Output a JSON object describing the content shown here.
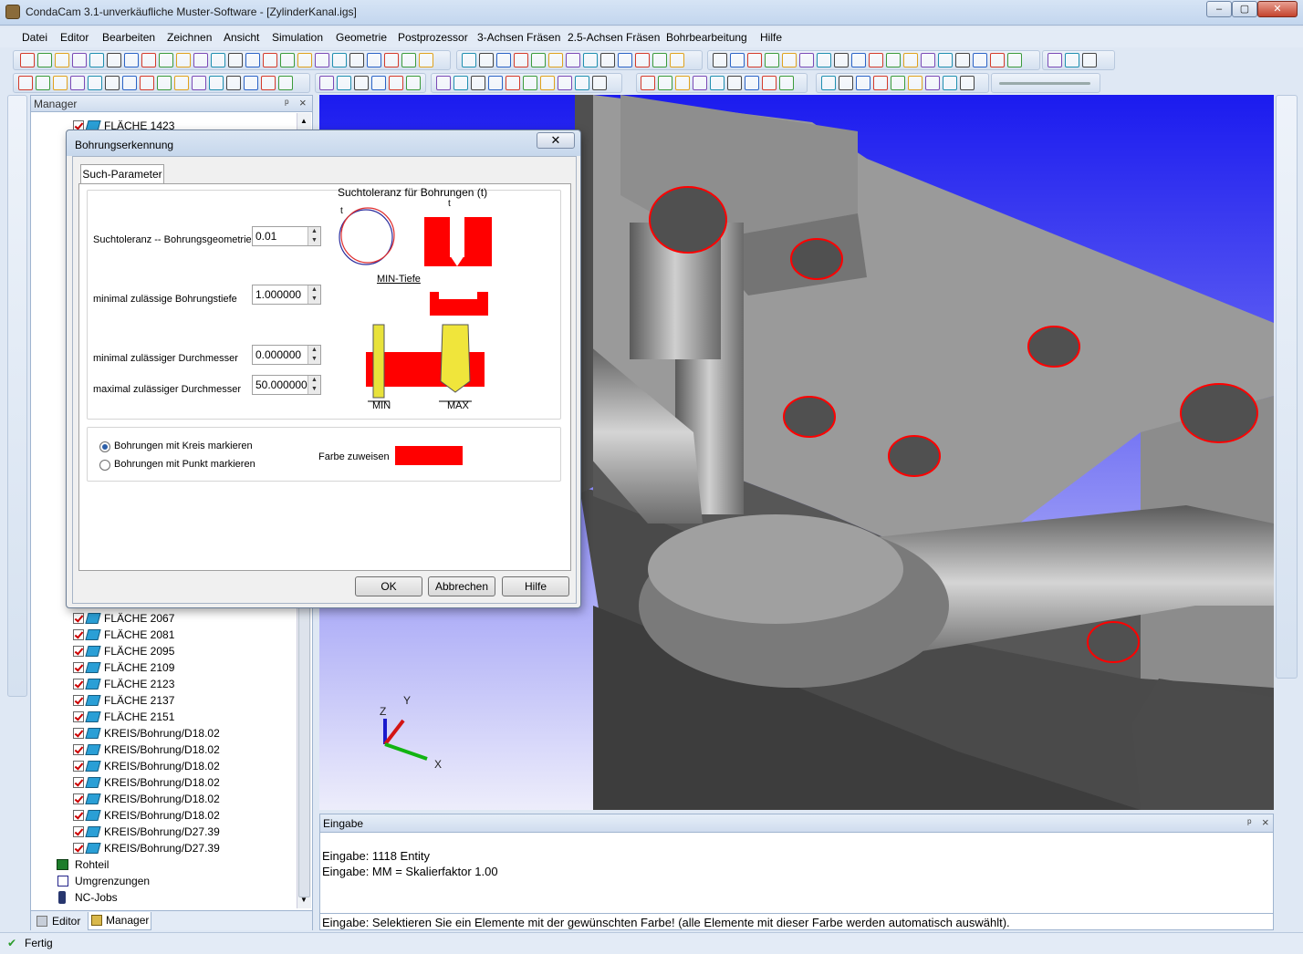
{
  "window": {
    "title": "CondaCam 3.1-unverkäufliche Muster-Software - [ZylinderKanal.igs]",
    "min": "–",
    "max": "▢",
    "close": "✕"
  },
  "menu": [
    "Datei",
    "Editor",
    "Bearbeiten",
    "Zeichnen",
    "Ansicht",
    "Simulation",
    "Geometrie",
    "Postprozessor",
    "3-Achsen Fräsen",
    "2.5-Achsen Fräsen",
    "Bohrbearbeitung",
    "Hilfe"
  ],
  "manager": {
    "title": "Manager",
    "pin": "ᵖ",
    "close": "×",
    "top_item": "FLÄCHE 1423",
    "items": [
      "FLÄCHE 2067",
      "FLÄCHE 2081",
      "FLÄCHE 2095",
      "FLÄCHE 2109",
      "FLÄCHE 2123",
      "FLÄCHE 2137",
      "FLÄCHE 2151",
      "KREIS/Bohrung/D18.02",
      "KREIS/Bohrung/D18.02",
      "KREIS/Bohrung/D18.02",
      "KREIS/Bohrung/D18.02",
      "KREIS/Bohrung/D18.02",
      "KREIS/Bohrung/D18.02",
      "KREIS/Bohrung/D27.39",
      "KREIS/Bohrung/D27.39"
    ],
    "groups": [
      "Rohteil",
      "Umgrenzungen",
      "NC-Jobs"
    ],
    "tabs": [
      "Editor",
      "Manager"
    ]
  },
  "dialog": {
    "title": "Bohrungserkennung",
    "close": "✕",
    "tab": "Such-Parameter",
    "tol_caption": "Suchtoleranz für Bohrungen (t)",
    "t_mark": "t",
    "min_tiefe": "MIN-Tiefe",
    "min_label": "MIN",
    "max_label": "MAX",
    "fields": [
      {
        "label": "Suchtoleranz -- Bohrungsgeometrie",
        "value": "0.01"
      },
      {
        "label": "minimal zulässige Bohrungstiefe",
        "value": "1.000000"
      },
      {
        "label": "minimal zulässiger Durchmesser",
        "value": "0.000000"
      },
      {
        "label": "maximal zulässiger Durchmesser",
        "value": "50.000000"
      }
    ],
    "radio_circle": "Bohrungen mit Kreis markieren",
    "radio_point": "Bohrungen mit Punkt markieren",
    "color_label": "Farbe zuweisen",
    "color": "#ff0000",
    "ok": "OK",
    "cancel": "Abbrechen",
    "help": "Hilfe"
  },
  "axes": {
    "x": "X",
    "y": "Y",
    "z": "Z"
  },
  "eingabe": {
    "title": "Eingabe",
    "pin": "ᵖ",
    "close": "×",
    "lines": [
      "Eingabe: 1118 Entity",
      "Eingabe: MM = Skalierfaktor 1.00"
    ],
    "command": "Eingabe: Selektieren Sie ein Elemente mit der gewünschten Farbe! (alle Elemente mit dieser Farbe werden automatisch auswählt)."
  },
  "status": {
    "text": "Fertig",
    "check_icon": "✔"
  },
  "colors": {
    "hole_marker": "#ff0000",
    "viewport_top": "#1b1bef",
    "part": "#9a9a9a"
  }
}
